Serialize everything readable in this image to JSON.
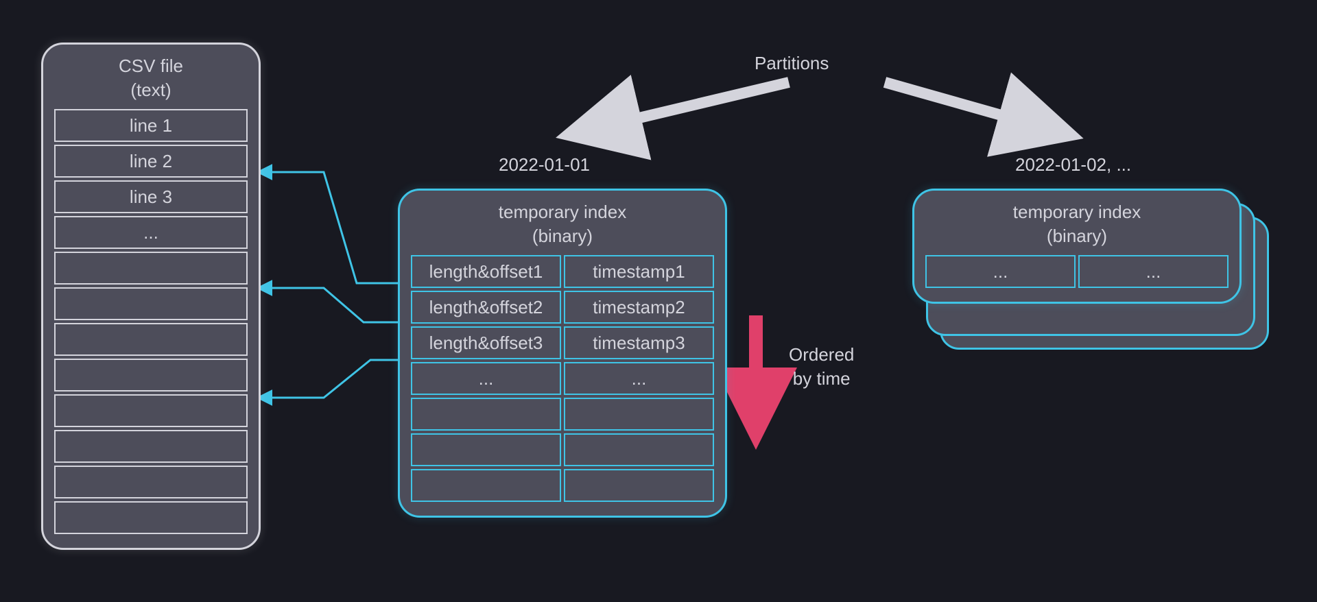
{
  "partitions_label": "Partitions",
  "csv": {
    "title_l1": "CSV file",
    "title_l2": "(text)",
    "rows": [
      "line 1",
      "line 2",
      "line 3",
      "...",
      "",
      "",
      "",
      "",
      "",
      "",
      "",
      ""
    ]
  },
  "partition1": {
    "date_label": "2022-01-01",
    "title_l1": "temporary index",
    "title_l2": "(binary)",
    "rows": [
      {
        "left": "length&offset1",
        "right": "timestamp1"
      },
      {
        "left": "length&offset2",
        "right": "timestamp2"
      },
      {
        "left": "length&offset3",
        "right": "timestamp3"
      },
      {
        "left": "...",
        "right": "..."
      },
      {
        "left": "",
        "right": ""
      },
      {
        "left": "",
        "right": ""
      },
      {
        "left": "",
        "right": ""
      }
    ]
  },
  "partition2": {
    "date_label": "2022-01-02, ...",
    "title_l1": "temporary index",
    "title_l2": "(binary)",
    "rows": [
      {
        "left": "...",
        "right": "..."
      }
    ]
  },
  "ordered_label": "Ordered\nby time"
}
